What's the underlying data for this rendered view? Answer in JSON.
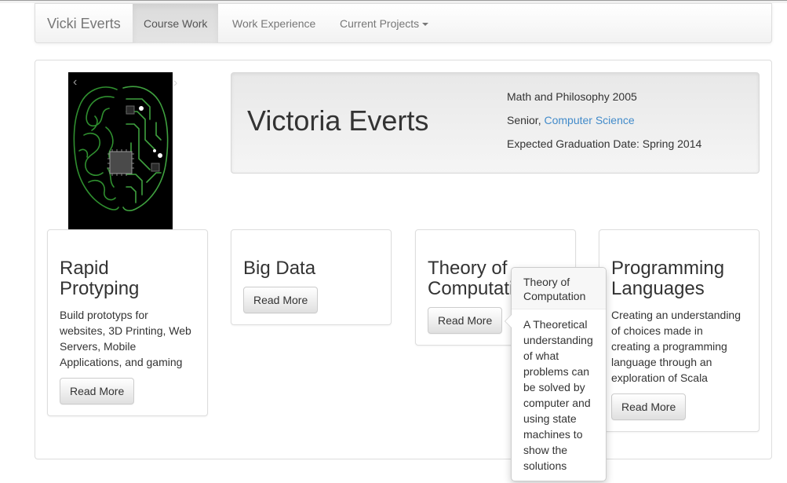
{
  "navbar": {
    "brand": "Vicki Everts",
    "items": [
      {
        "label": "Course Work",
        "active": true
      },
      {
        "label": "Work Experience",
        "active": false
      },
      {
        "label": "Current Projects",
        "active": false,
        "dropdown": true
      }
    ]
  },
  "carousel": {
    "prev_label": "‹",
    "next_label": "›"
  },
  "jumbotron": {
    "name": "Victoria Everts",
    "line1": "Math and Philosophy 2005",
    "line2_prefix": "Senior, ",
    "line2_link": "Computer Science",
    "line3": "Expected Graduation Date: Spring 2014"
  },
  "cards": [
    {
      "title_line1": "Rapid",
      "title_line2": "Protyping",
      "text_lines": [
        "Build prototyps for",
        "websites, 3D Printing, Web",
        "Servers, Mobile",
        "Applications, and gaming"
      ],
      "button": "Read More"
    },
    {
      "title_line1": "Big Data",
      "title_line2": "",
      "text_lines": [],
      "button": "Read More"
    },
    {
      "title_line1": "Theory of",
      "title_line2": "Computation",
      "text_lines": [],
      "button": "Read More"
    },
    {
      "title_line1": "Programming",
      "title_line2": "Languages",
      "text_lines": [
        "Creating an understanding",
        "of choices made in",
        "creating a programming",
        "language through an",
        "exploration of Scala"
      ],
      "button": "Read More"
    }
  ],
  "popover": {
    "title_line1": "Theory of",
    "title_line2": "Computation",
    "lines": [
      "A Theoretical",
      "understanding",
      "of what",
      "problems can",
      "be solved by",
      "computer and",
      "using state",
      "machines to",
      "show the",
      "solutions"
    ]
  },
  "colors": {
    "link": "#428bca",
    "circuit_green": "#3fa13f"
  }
}
